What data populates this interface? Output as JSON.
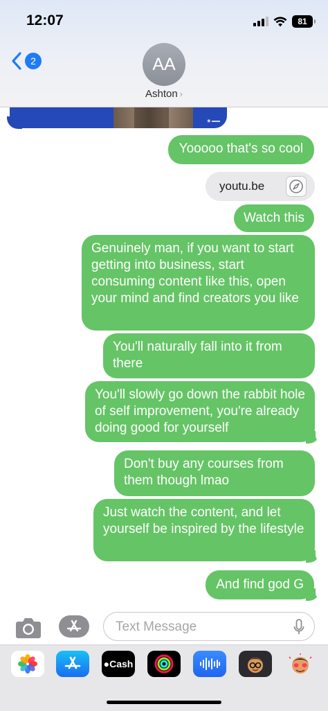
{
  "status_bar": {
    "time": "12:07",
    "battery": "81"
  },
  "header": {
    "back_badge": "2",
    "avatar_initials": "AA",
    "contact_name": "Ashton"
  },
  "messages": [
    {
      "text": "Yooooo that's so cool"
    },
    {
      "link_text": "youtu.be"
    },
    {
      "text": "Watch this"
    },
    {
      "text": "Genuinely man, if you want to start getting into business, start consuming content like this, open your mind and find creators you like"
    },
    {
      "text": "You'll naturally fall into it from there"
    },
    {
      "text": "You'll slowly go down the rabbit hole of self improvement, you're already doing good for yourself"
    },
    {
      "text": "Don't buy any courses from them though lmao"
    },
    {
      "text": "Just watch the content, and let yourself be inspired by the lifestyle"
    },
    {
      "text": "And find god G"
    }
  ],
  "compose": {
    "placeholder": "Text Message"
  },
  "app_drawer": {
    "apps": [
      {
        "name": "photos-app-icon"
      },
      {
        "name": "app-store-app-icon"
      },
      {
        "name": "apple-cash-app-icon",
        "label": "Cash"
      },
      {
        "name": "fitness-app-icon"
      },
      {
        "name": "audio-message-app-icon"
      },
      {
        "name": "memoji-app-icon"
      },
      {
        "name": "memoji-stickers-app-icon"
      }
    ]
  },
  "colors": {
    "bubble_green": "#65c466",
    "accent_blue": "#1f7cf7",
    "link_pill_gray": "#e9e9eb"
  }
}
